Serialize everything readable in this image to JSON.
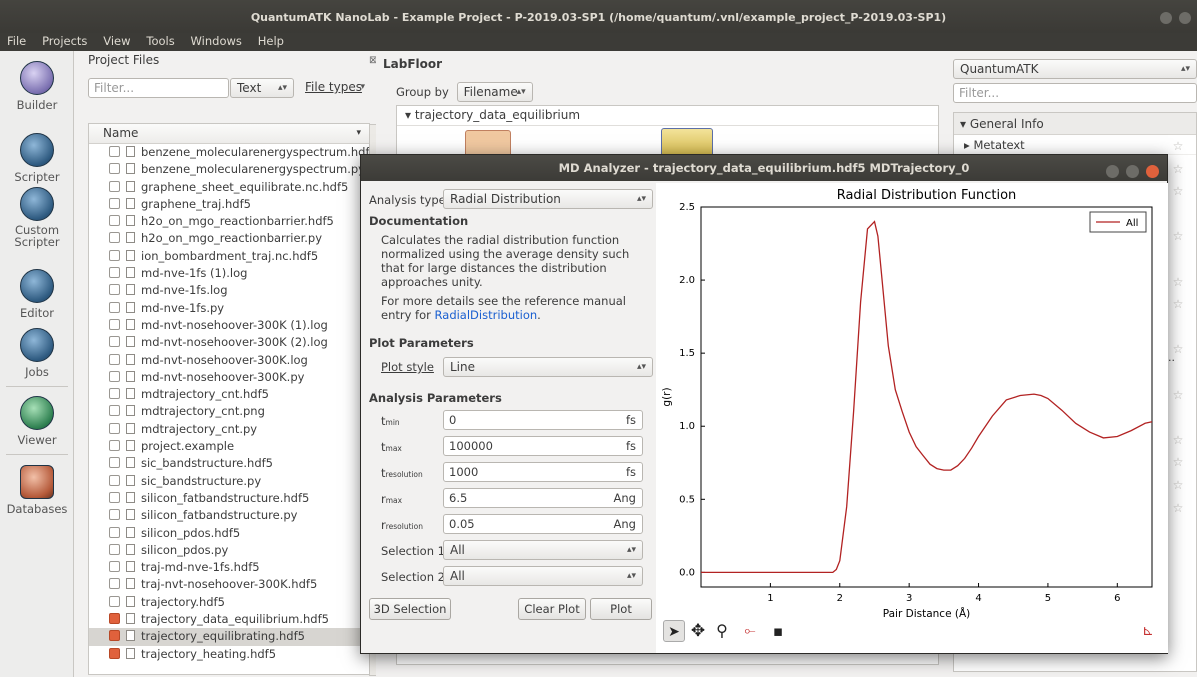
{
  "window": {
    "title": "QuantumATK NanoLab - Example Project - P-2019.03-SP1 (/home/quantum/.vnl/example_project_P-2019.03-SP1)"
  },
  "menu": [
    "File",
    "Projects",
    "View",
    "Tools",
    "Windows",
    "Help"
  ],
  "tools": [
    {
      "label": "Builder",
      "icon": "builder-icon"
    },
    {
      "label": "Scripter",
      "icon": "scripter-icon"
    },
    {
      "label": "Custom Scripter",
      "icon": "custom-scripter-icon"
    },
    {
      "label": "Editor",
      "icon": "editor-icon"
    },
    {
      "label": "Jobs",
      "icon": "jobs-icon"
    },
    {
      "label": "Viewer",
      "icon": "viewer-icon"
    },
    {
      "label": "Databases",
      "icon": "databases-icon"
    }
  ],
  "project_files": {
    "header": "Project Files",
    "filter_placeholder": "Filter...",
    "filter_mode": "Text",
    "file_types": "File types",
    "column": "Name",
    "files": [
      {
        "name": "benzene_molecularenergyspectrum.hdf5",
        "checked": false
      },
      {
        "name": "benzene_molecularenergyspectrum.py",
        "checked": false
      },
      {
        "name": "graphene_sheet_equilibrate.nc.hdf5",
        "checked": false
      },
      {
        "name": "graphene_traj.hdf5",
        "checked": false
      },
      {
        "name": "h2o_on_mgo_reactionbarrier.hdf5",
        "checked": false
      },
      {
        "name": "h2o_on_mgo_reactionbarrier.py",
        "checked": false
      },
      {
        "name": "ion_bombardment_traj.nc.hdf5",
        "checked": false
      },
      {
        "name": "md-nve-1fs (1).log",
        "checked": false
      },
      {
        "name": "md-nve-1fs.log",
        "checked": false
      },
      {
        "name": "md-nve-1fs.py",
        "checked": false
      },
      {
        "name": "md-nvt-nosehoover-300K (1).log",
        "checked": false
      },
      {
        "name": "md-nvt-nosehoover-300K (2).log",
        "checked": false
      },
      {
        "name": "md-nvt-nosehoover-300K.log",
        "checked": false
      },
      {
        "name": "md-nvt-nosehoover-300K.py",
        "checked": false
      },
      {
        "name": "mdtrajectory_cnt.hdf5",
        "checked": false
      },
      {
        "name": "mdtrajectory_cnt.png",
        "checked": false
      },
      {
        "name": "mdtrajectory_cnt.py",
        "checked": false
      },
      {
        "name": "project.example",
        "checked": false
      },
      {
        "name": "sic_bandstructure.hdf5",
        "checked": false
      },
      {
        "name": "sic_bandstructure.py",
        "checked": false
      },
      {
        "name": "silicon_fatbandstructure.hdf5",
        "checked": false
      },
      {
        "name": "silicon_fatbandstructure.py",
        "checked": false
      },
      {
        "name": "silicon_pdos.hdf5",
        "checked": false
      },
      {
        "name": "silicon_pdos.py",
        "checked": false
      },
      {
        "name": "traj-md-nve-1fs.hdf5",
        "checked": false
      },
      {
        "name": "traj-nvt-nosehoover-300K.hdf5",
        "checked": false
      },
      {
        "name": "trajectory.hdf5",
        "checked": false
      },
      {
        "name": "trajectory_data_equilibrium.hdf5",
        "checked": true
      },
      {
        "name": "trajectory_equilibrating.hdf5",
        "checked": true,
        "selected": true
      },
      {
        "name": "trajectory_heating.hdf5",
        "checked": true
      }
    ]
  },
  "labfloor": {
    "title": "LabFloor",
    "group_by_label": "Group by",
    "group_by_value": "Filename",
    "group": "trajectory_data_equilibrium"
  },
  "right_panel": {
    "combo": "QuantumATK",
    "filter_placeholder": "Filter...",
    "section": "General Info",
    "item": "Metatext",
    "truncated": "r..."
  },
  "dialog": {
    "title": "MD Analyzer - trajectory_data_equilibrium.hdf5 MDTrajectory_0",
    "analysis_type_label": "Analysis type",
    "analysis_type": "Radial Distribution",
    "doc_heading": "Documentation",
    "doc_text": "Calculates the radial distribution function normalized using the average density such that for large distances the distribution approaches unity.",
    "doc_more": "For more details see the reference manual entry for",
    "doc_link": "RadialDistribution",
    "doc_end": ".",
    "plot_params": "Plot Parameters",
    "plot_style_label": "Plot style",
    "plot_style": "Line",
    "analysis_params": "Analysis Parameters",
    "params": [
      {
        "name": "t",
        "sub": "min",
        "value": "0",
        "unit": "fs"
      },
      {
        "name": "t",
        "sub": "max",
        "value": "100000",
        "unit": "fs"
      },
      {
        "name": "t",
        "sub": "resolution",
        "value": "1000",
        "unit": "fs"
      },
      {
        "name": "r",
        "sub": "max",
        "value": "6.5",
        "unit": "Ang"
      },
      {
        "name": "r",
        "sub": "resolution",
        "value": "0.05",
        "unit": "Ang"
      }
    ],
    "selection1_label": "Selection 1",
    "selection1": "All",
    "selection2_label": "Selection 2",
    "selection2": "All",
    "btn_3d": "3D Selection",
    "btn_clear": "Clear Plot",
    "btn_plot": "Plot"
  },
  "chart_data": {
    "type": "line",
    "title": "Radial Distribution Function",
    "xlabel": "Pair Distance (Å)",
    "ylabel": "g(r)",
    "xlim": [
      0,
      6.5
    ],
    "ylim": [
      -0.1,
      2.5
    ],
    "xticks": [
      1,
      2,
      3,
      4,
      5,
      6
    ],
    "yticks": [
      0.0,
      0.5,
      1.0,
      1.5,
      2.0,
      2.5
    ],
    "legend_position": "top-right",
    "color": "#b22222",
    "series": [
      {
        "name": "All",
        "x": [
          0.0,
          1.9,
          1.95,
          2.0,
          2.1,
          2.2,
          2.3,
          2.4,
          2.5,
          2.55,
          2.6,
          2.7,
          2.8,
          2.9,
          3.0,
          3.1,
          3.2,
          3.3,
          3.4,
          3.5,
          3.6,
          3.7,
          3.8,
          3.9,
          4.0,
          4.2,
          4.4,
          4.6,
          4.8,
          4.9,
          5.0,
          5.2,
          5.4,
          5.6,
          5.8,
          6.0,
          6.2,
          6.4,
          6.5
        ],
        "y": [
          0.0,
          0.0,
          0.02,
          0.08,
          0.45,
          1.1,
          1.85,
          2.35,
          2.4,
          2.3,
          2.05,
          1.55,
          1.25,
          1.1,
          0.96,
          0.86,
          0.8,
          0.74,
          0.71,
          0.7,
          0.7,
          0.73,
          0.78,
          0.85,
          0.93,
          1.07,
          1.18,
          1.21,
          1.22,
          1.21,
          1.19,
          1.11,
          1.02,
          0.96,
          0.92,
          0.93,
          0.97,
          1.02,
          1.03
        ]
      }
    ]
  }
}
